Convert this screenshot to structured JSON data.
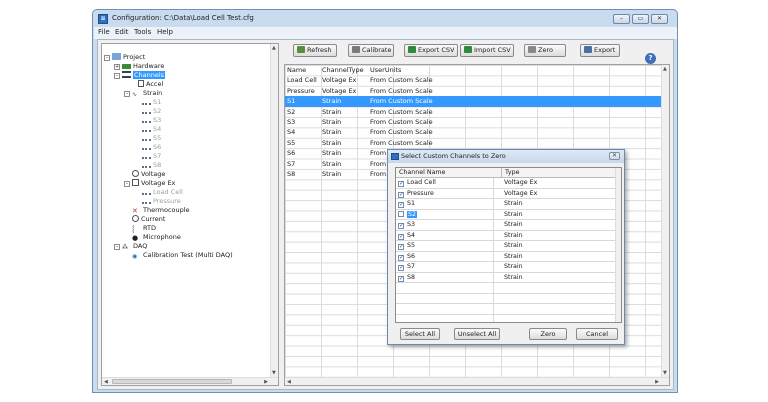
{
  "window": {
    "title": "Configuration: C:\\Data\\Load Cell Test.cfg",
    "app_icon": "app-icon",
    "controls": [
      "minimize",
      "maximize",
      "close"
    ]
  },
  "menu": {
    "items": [
      "File",
      "Edit",
      "Tools",
      "Help"
    ]
  },
  "tree": {
    "project": "Project",
    "hardware": "Hardware",
    "channels": "Channels",
    "accel": "Accel",
    "strain": "Strain",
    "strain_items": [
      "S1",
      "S2",
      "S3",
      "S4",
      "S5",
      "S6",
      "S7",
      "S8"
    ],
    "voltage": "Voltage",
    "voltage_ex": "Voltage Ex",
    "voltage_ex_items": [
      "Load Cell",
      "Pressure"
    ],
    "thermocouple": "Thermocouple",
    "current": "Current",
    "rtd": "RTD",
    "microphone": "Microphone",
    "daq": "DAQ",
    "calibration_test": "Calibration Test (Multi DAQ)"
  },
  "toolbar": {
    "refresh": "Refresh",
    "calibrate": "Calibrate",
    "export_csv": "Export CSV",
    "import_csv": "Import CSV",
    "zero": "Zero",
    "export": "Export",
    "help_icon": "?"
  },
  "grid": {
    "headers": [
      "Name",
      "ChannelType",
      "UserUnits"
    ],
    "rows": [
      [
        "Load Cell",
        "Voltage Ex",
        "From Custom Scale"
      ],
      [
        "Pressure",
        "Voltage Ex",
        "From Custom Scale"
      ],
      [
        "S1",
        "Strain",
        "From Custom Scale"
      ],
      [
        "S2",
        "Strain",
        "From Custom Scale"
      ],
      [
        "S3",
        "Strain",
        "From Custom Scale"
      ],
      [
        "S4",
        "Strain",
        "From Custom Scale"
      ],
      [
        "S5",
        "Strain",
        "From Custom Scale"
      ],
      [
        "S6",
        "Strain",
        "From"
      ],
      [
        "S7",
        "Strain",
        "From"
      ],
      [
        "S8",
        "Strain",
        "From"
      ]
    ],
    "selected_row": "S1"
  },
  "dialog": {
    "title": "Select Custom Channels to Zero",
    "close": "✕",
    "col_name": "Channel Name",
    "col_type": "Type",
    "rows": [
      {
        "name": "Load Cell",
        "type": "Voltage Ex",
        "checked": true
      },
      {
        "name": "Pressure",
        "type": "Voltage Ex",
        "checked": true
      },
      {
        "name": "S1",
        "type": "Strain",
        "checked": true
      },
      {
        "name": "S2",
        "type": "Strain",
        "checked": false
      },
      {
        "name": "S3",
        "type": "Strain",
        "checked": true
      },
      {
        "name": "S4",
        "type": "Strain",
        "checked": true
      },
      {
        "name": "S5",
        "type": "Strain",
        "checked": true
      },
      {
        "name": "S6",
        "type": "Strain",
        "checked": true
      },
      {
        "name": "S7",
        "type": "Strain",
        "checked": true
      },
      {
        "name": "S8",
        "type": "Strain",
        "checked": true
      }
    ],
    "select_all": "Select All",
    "unselect_all": "Unselect All",
    "zero": "Zero",
    "cancel": "Cancel"
  },
  "colors": {
    "selection": "#3399ff",
    "frame": "#c9dbef",
    "title_accent": "#2e6fc0"
  }
}
